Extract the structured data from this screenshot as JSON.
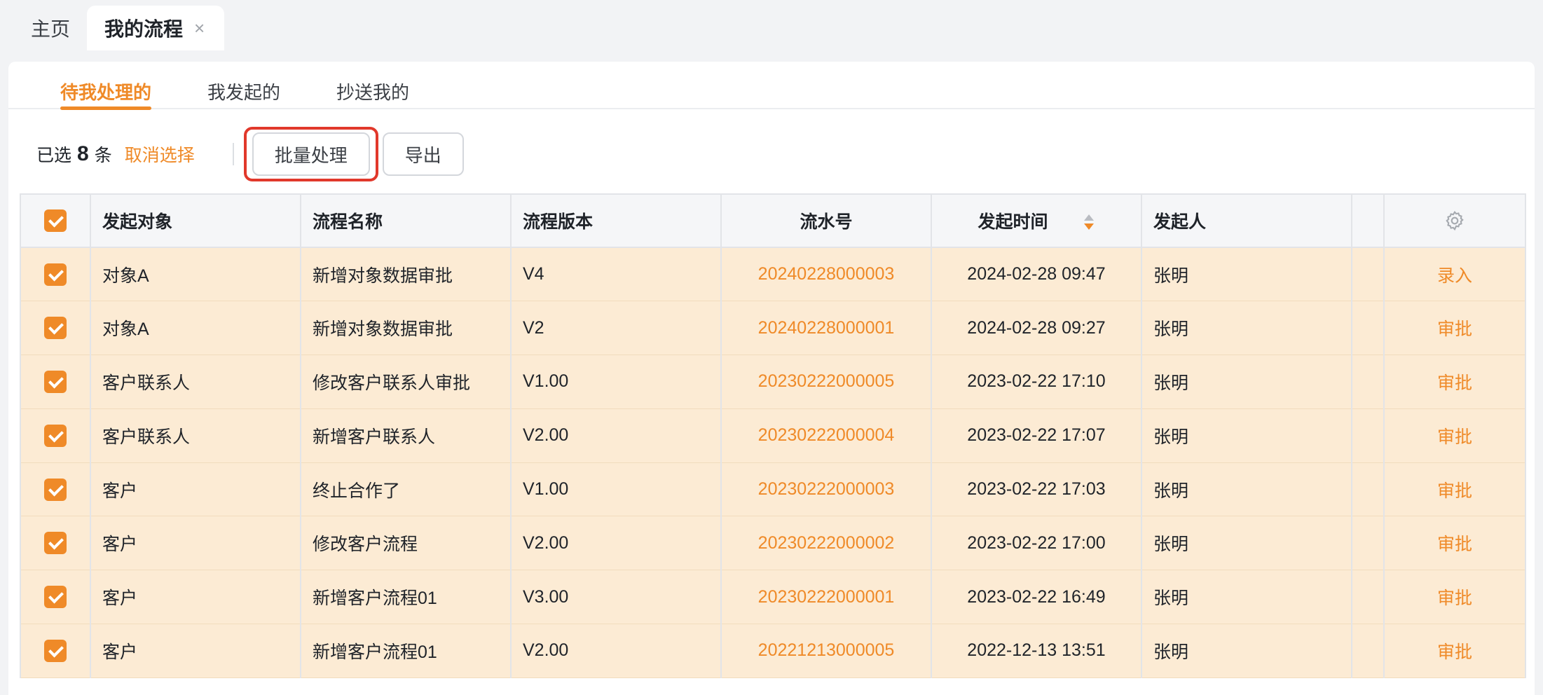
{
  "page_tabs": [
    {
      "label": "主页"
    },
    {
      "label": "我的流程",
      "active": true,
      "close_glyph": "×"
    }
  ],
  "sub_tabs": [
    {
      "label": "待我处理的",
      "active": true
    },
    {
      "label": "我发起的"
    },
    {
      "label": "抄送我的"
    }
  ],
  "toolbar": {
    "selected_prefix": "已选",
    "selected_count": "8",
    "selected_suffix": "条",
    "cancel_label": "取消选择",
    "batch_label": "批量处理",
    "export_label": "导出"
  },
  "table": {
    "columns": [
      "发起对象",
      "流程名称",
      "流程版本",
      "流水号",
      "发起时间",
      "发起人"
    ],
    "settings_icon": "gear-icon",
    "rows": [
      {
        "object": "对象A",
        "name": "新增对象数据审批",
        "version": "V4",
        "serial": "20240228000003",
        "time": "2024-02-28 09:47",
        "initiator": "张明",
        "action": "录入"
      },
      {
        "object": "对象A",
        "name": "新增对象数据审批",
        "version": "V2",
        "serial": "20240228000001",
        "time": "2024-02-28 09:27",
        "initiator": "张明",
        "action": "审批"
      },
      {
        "object": "客户联系人",
        "name": "修改客户联系人审批",
        "version": "V1.00",
        "serial": "20230222000005",
        "time": "2023-02-22 17:10",
        "initiator": "张明",
        "action": "审批"
      },
      {
        "object": "客户联系人",
        "name": "新增客户联系人",
        "version": "V2.00",
        "serial": "20230222000004",
        "time": "2023-02-22 17:07",
        "initiator": "张明",
        "action": "审批"
      },
      {
        "object": "客户",
        "name": "终止合作了",
        "version": "V1.00",
        "serial": "20230222000003",
        "time": "2023-02-22 17:03",
        "initiator": "张明",
        "action": "审批"
      },
      {
        "object": "客户",
        "name": "修改客户流程",
        "version": "V2.00",
        "serial": "20230222000002",
        "time": "2023-02-22 17:00",
        "initiator": "张明",
        "action": "审批"
      },
      {
        "object": "客户",
        "name": "新增客户流程01",
        "version": "V3.00",
        "serial": "20230222000001",
        "time": "2023-02-22 16:49",
        "initiator": "张明",
        "action": "审批"
      },
      {
        "object": "客户",
        "name": "新增客户流程01",
        "version": "V2.00",
        "serial": "20221213000005",
        "time": "2022-12-13 13:51",
        "initiator": "张明",
        "action": "审批"
      }
    ]
  },
  "colors": {
    "accent": "#ef8a28",
    "row_selected_bg": "#fcebd4",
    "highlight_border": "#e1382b"
  }
}
